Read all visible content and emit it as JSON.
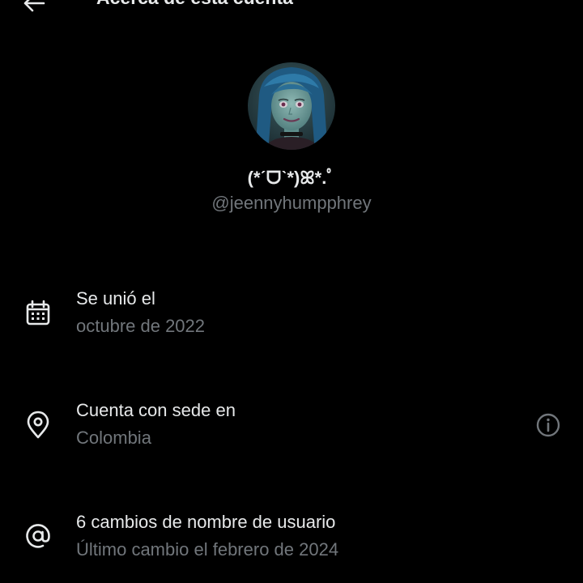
{
  "header": {
    "title": "Acerca de esta cuenta",
    "back_icon": "arrow-left-icon"
  },
  "profile": {
    "display_name": "(*ˊᗜˋ*)ꕤ*.ﾟ",
    "handle": "@jeennyhumpphrey"
  },
  "rows": [
    {
      "icon": "calendar-icon",
      "primary": "Se unió el",
      "secondary": "octubre de 2022"
    },
    {
      "icon": "location-pin-icon",
      "primary": "Cuenta con sede en",
      "secondary": "Colombia",
      "trailing_icon": "info-icon"
    },
    {
      "icon": "at-sign-icon",
      "primary": "6 cambios de nombre de usuario",
      "secondary": "Último cambio el febrero de 2024"
    }
  ],
  "colors": {
    "background": "#000000",
    "primary_text": "#e7e9ea",
    "secondary_text": "#71767b"
  }
}
